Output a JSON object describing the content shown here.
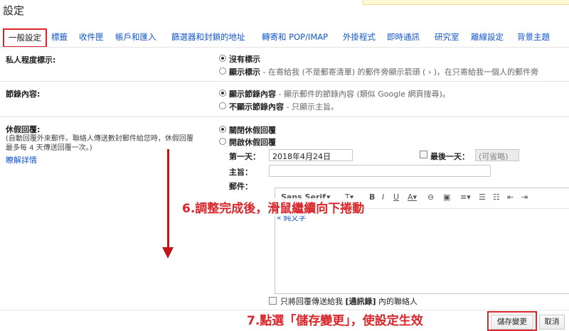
{
  "page_title": "設定",
  "tabs": [
    {
      "label": "一般設定",
      "active": true
    },
    {
      "label": "標籤"
    },
    {
      "label": "收件匣"
    },
    {
      "label": "帳戶和匯入"
    },
    {
      "label": "篩選器和封鎖的地址"
    },
    {
      "label": "轉寄和 POP/IMAP"
    },
    {
      "label": "外掛程式"
    },
    {
      "label": "即時通訊"
    },
    {
      "label": "研究室"
    },
    {
      "label": "離線設定"
    },
    {
      "label": "背景主題"
    }
  ],
  "sections": {
    "privacy": {
      "label": "私人程度標示:",
      "opt1": "沒有標示",
      "opt2_bold": "顯示標示",
      "opt2_desc": " - 在寄給我 (不是郵寄清單) 的郵件旁顯示箭頭 ( › )，在只寄給我一個人的郵件旁"
    },
    "snippets": {
      "label": "節錄內容:",
      "opt1_bold": "顯示節錄內容",
      "opt1_desc": " - 顯示郵件的節錄內容 (類似 Google 網頁搜尋)。",
      "opt2_bold": "不顯示節錄內容",
      "opt2_desc": " - 只顯示主旨。"
    },
    "vacation": {
      "label": "休假回覆:",
      "desc1": "(自動回覆外來郵件。聯絡人傳送數封郵件給您時，休假回覆",
      "desc2": "最多每 4 天傳送回覆一次。)",
      "learn_more": "瞭解詳情",
      "off": "關閉休假回覆",
      "on": "開啟休假回覆",
      "first_day_label": "第一天：",
      "first_day_value": "2018年4月24日",
      "last_day_label": "最後一天：",
      "last_day_placeholder": "(可省略)",
      "subject_label": "主旨：",
      "message_label": "郵件：",
      "font_name": "Sans Serif",
      "plain_text_link": "« 純文字",
      "contacts_only_pre": "只將回覆傳送給我 ",
      "contacts_only_bold": "[通訊錄]",
      "contacts_only_post": " 內的聯絡人"
    }
  },
  "buttons": {
    "save": "儲存變更",
    "cancel": "取消"
  },
  "annotations": {
    "step6": "6.調整完成後，滑鼠繼續向下捲動",
    "step7": "7.點選「儲存變更」，使設定生效"
  },
  "colors": {
    "accent": "#d9262b",
    "link": "#1155cc"
  }
}
